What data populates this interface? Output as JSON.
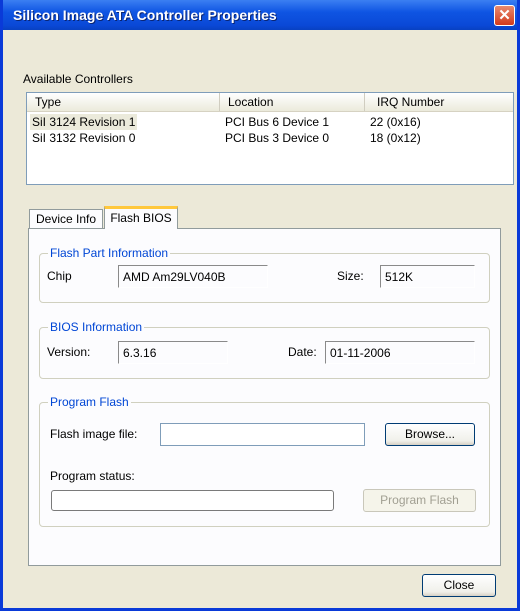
{
  "window": {
    "title": "Silicon Image ATA Controller Properties",
    "close_glyph": "✕"
  },
  "controllers": {
    "label": "Available Controllers",
    "columns": [
      "Type",
      "Location",
      "IRQ Number"
    ],
    "rows": [
      {
        "type": "SiI 3124 Revision 1",
        "location": "PCI Bus 6 Device 1",
        "irq": "22 (0x16)"
      },
      {
        "type": "SiI 3132 Revision 0",
        "location": "PCI Bus 3 Device 0",
        "irq": "18 (0x12)"
      }
    ]
  },
  "tabs": [
    "Device Info",
    "Flash BIOS"
  ],
  "flash_part": {
    "title": "Flash Part Information",
    "chip_label": "Chip",
    "chip_value": "AMD Am29LV040B",
    "size_label": "Size:",
    "size_value": "512K"
  },
  "bios": {
    "title": "BIOS Information",
    "version_label": "Version:",
    "version_value": "6.3.16",
    "date_label": "Date:",
    "date_value": "01-11-2006"
  },
  "program": {
    "title": "Program Flash",
    "file_label": "Flash image file:",
    "file_value": "",
    "browse_label": "Browse...",
    "status_label": "Program status:",
    "status_progress": 0,
    "program_button": "Program Flash"
  },
  "close_button": "Close"
}
